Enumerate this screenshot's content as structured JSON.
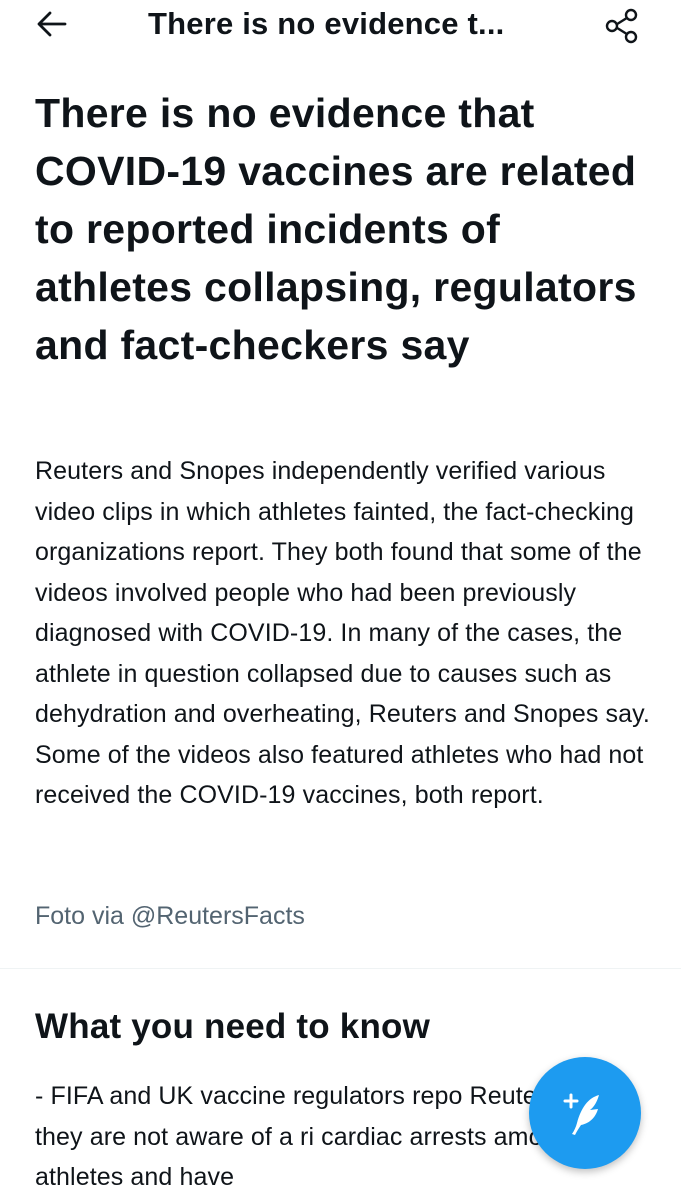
{
  "header": {
    "title": "There is no evidence t...",
    "back_icon": "arrow-left-icon",
    "share_icon": "share-icon"
  },
  "article": {
    "headline": "There is no evidence that COVID-19 vaccines are related to reported incidents of athletes collapsing, regulators and fact-checkers say",
    "summary": "Reuters and Snopes independently verified various video clips in which athletes fainted, the fact-checking organizations report. They both found that some of the videos involved people who had been previously diagnosed with COVID-19. In many of the cases, the athlete in question collapsed due to causes such as dehydration and overheating, Reuters and Snopes say. Some of the videos also featured athletes who had not received the COVID-19 vaccines, both report.",
    "photo_credit": "Foto via @ReutersFacts"
  },
  "what_to_know": {
    "title": "What you need to know",
    "body": "- FIFA and UK vaccine regulators repo Reuters that they are not aware of a ri cardiac arrests among athletes and have"
  },
  "fab": {
    "icon": "compose-tweet-icon"
  },
  "colors": {
    "accent": "#1d9bf0",
    "text": "#0f1419",
    "secondary_text": "#536471"
  }
}
